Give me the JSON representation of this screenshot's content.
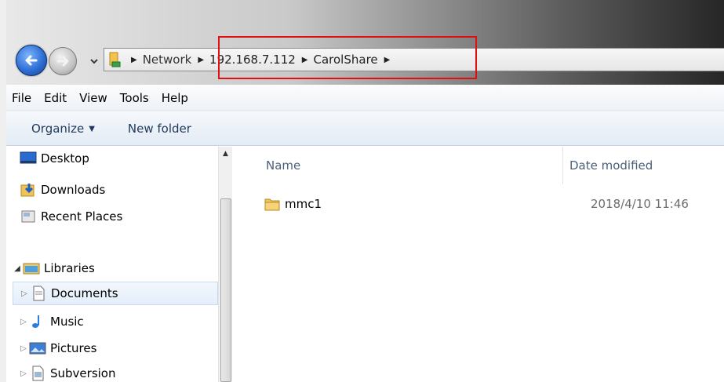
{
  "nav": {
    "back_icon": "back-arrow-icon",
    "forward_icon": "forward-arrow-icon",
    "recent_icon": "chevron-down-icon"
  },
  "address_bar": {
    "crumbs": [
      "Network",
      "192.168.7.112",
      "CarolShare"
    ],
    "highlight_color": "#e01010"
  },
  "menu": {
    "items": [
      "File",
      "Edit",
      "View",
      "Tools",
      "Help"
    ]
  },
  "toolbar": {
    "organize_label": "Organize",
    "new_folder_label": "New folder"
  },
  "nav_pane": {
    "favorites": [
      "Desktop",
      "Downloads",
      "Recent Places"
    ],
    "libraries_label": "Libraries",
    "libraries": [
      "Documents",
      "Music",
      "Pictures",
      "Subversion"
    ],
    "selected": "Documents"
  },
  "columns": {
    "name": "Name",
    "date_modified": "Date modified"
  },
  "files": [
    {
      "name": "mmc1",
      "date_modified": "2018/4/10 11:46",
      "icon": "folder-icon"
    }
  ],
  "colors": {
    "accent": "#2f6fd6",
    "selection_bg": "#e4eef9",
    "header_text": "#4c607a"
  }
}
